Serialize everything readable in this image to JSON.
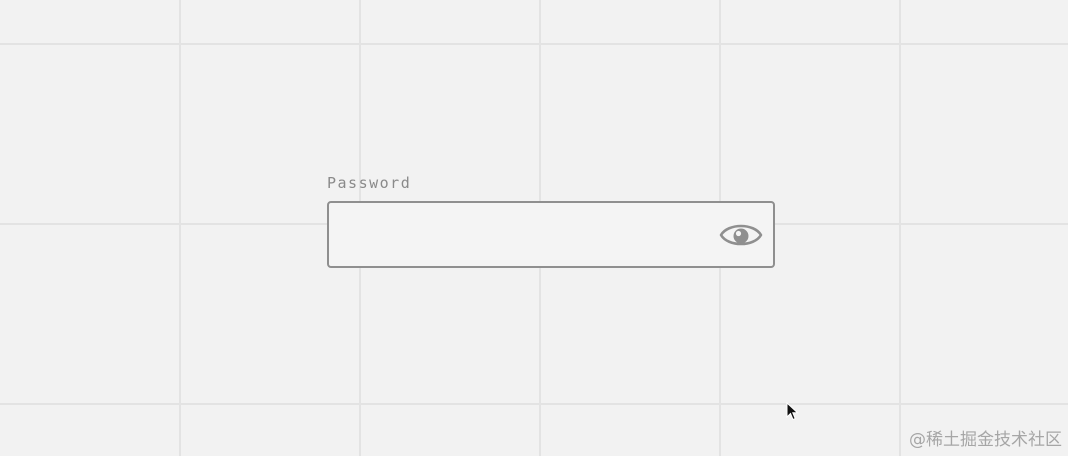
{
  "form": {
    "password_label": "Password",
    "password_value": "",
    "password_placeholder": "",
    "toggle_icon": "eye-icon"
  },
  "watermark": {
    "text": "@稀土掘金技术社区"
  },
  "colors": {
    "background": "#f2f2f2",
    "grid": "#e3e3e3",
    "border": "#8f8f8f",
    "label": "#8a8a8a",
    "icon": "#8f8f8f"
  }
}
